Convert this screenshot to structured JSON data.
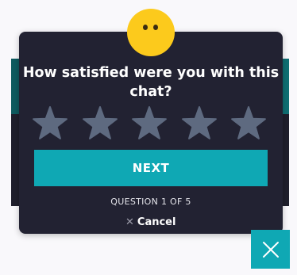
{
  "survey": {
    "question": "How satisfied were you with this chat?",
    "rating": {
      "max": 5,
      "selected": 0,
      "star_color": "#5e6a80"
    },
    "next_label": "NEXT",
    "progress": "QUESTION 1 OF 5",
    "cancel_label": "Cancel",
    "cancel_icon": "close-icon"
  },
  "widget": {
    "close_icon": "close-icon"
  },
  "colors": {
    "card_bg": "#222232",
    "accent": "#0fa8b4",
    "emoji": "#fcca1c"
  }
}
